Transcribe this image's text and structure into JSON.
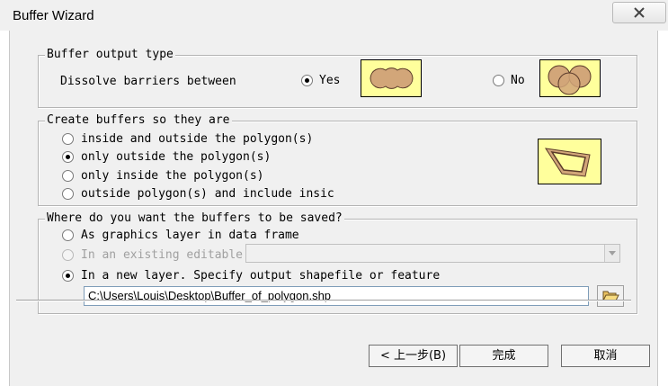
{
  "window": {
    "title": "Buffer Wizard"
  },
  "output_type": {
    "legend": "Buffer output type",
    "dissolve_label": "Dissolve barriers between",
    "yes_label": "Yes",
    "no_label": "No",
    "selected": "yes"
  },
  "create_buffers": {
    "legend": "Create buffers so they are",
    "options": [
      {
        "label": "inside and outside the polygon(s)",
        "checked": false
      },
      {
        "label": "only outside the polygon(s)",
        "checked": true
      },
      {
        "label": "only inside the polygon(s)",
        "checked": false
      },
      {
        "label": "outside polygon(s) and include insic",
        "checked": false
      }
    ]
  },
  "save_location": {
    "legend": "Where do you want the buffers to be saved?",
    "options": [
      {
        "label": "As graphics layer in data frame",
        "checked": false,
        "enabled": true
      },
      {
        "label": "In an existing editable",
        "checked": false,
        "enabled": false
      },
      {
        "label": "In a new layer.  Specify output shapefile or feature",
        "checked": true,
        "enabled": true
      }
    ],
    "existing_layer_value": "",
    "output_path": "C:\\Users\\Louis\\Desktop\\Buffer_of_polygon.shp"
  },
  "buttons": {
    "back": "< 上一步(B)",
    "finish": "完成",
    "cancel": "取消"
  },
  "colors": {
    "preview_bg": "#ffff9c",
    "buffer_fill": "#d2a679",
    "polygon_stroke": "#5a3a2a"
  },
  "icons": [
    "close-icon",
    "folder-open-icon"
  ]
}
